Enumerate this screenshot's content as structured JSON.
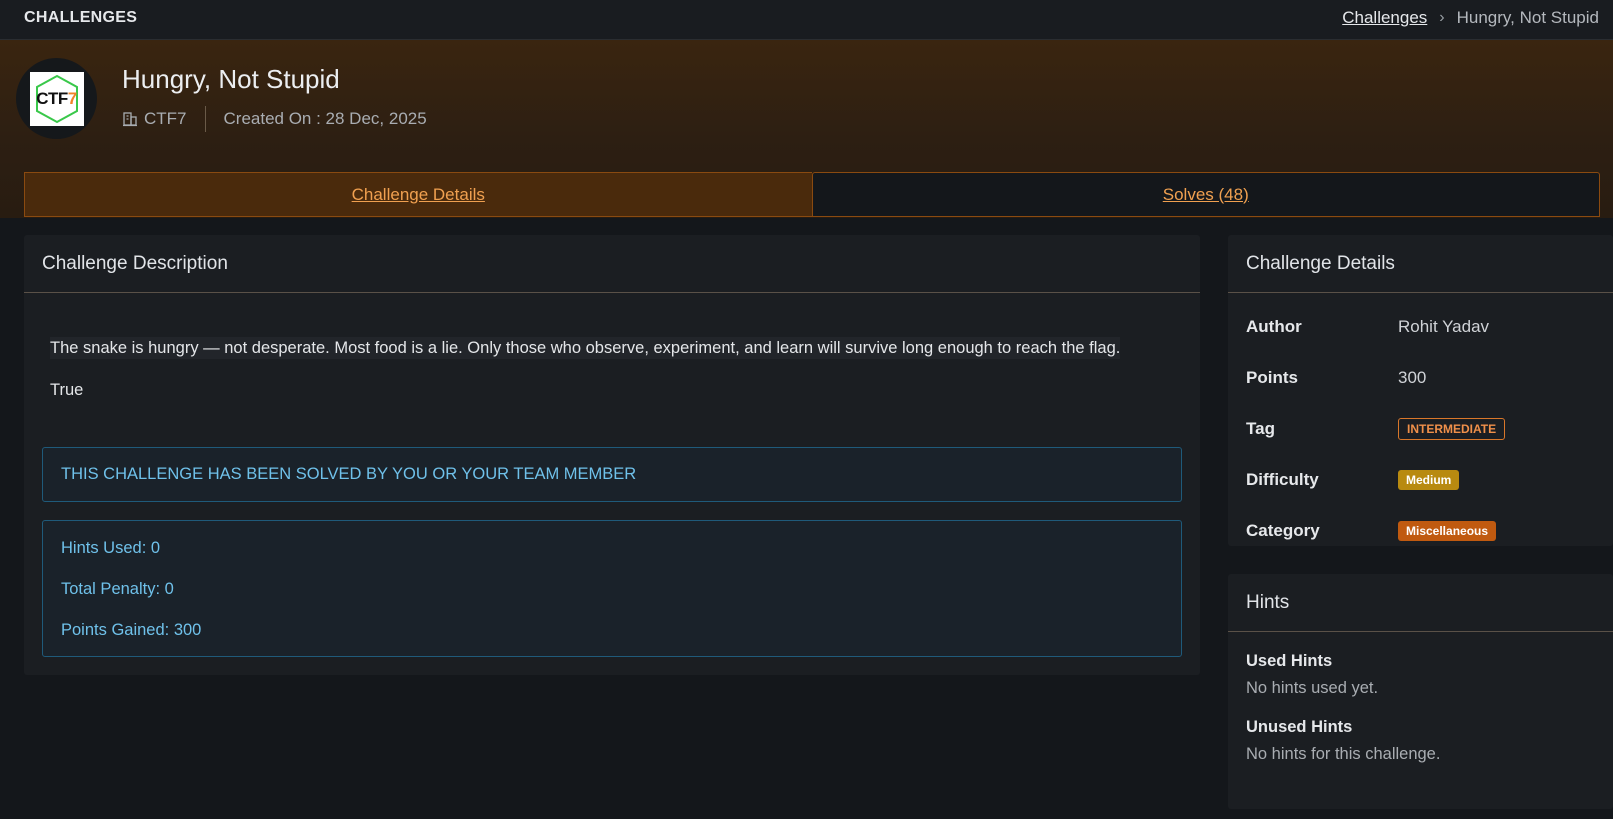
{
  "topbar": {
    "title": "CHALLENGES",
    "breadcrumb": {
      "link": "Challenges",
      "separator": "›",
      "current": "Hungry, Not Stupid"
    }
  },
  "header": {
    "logo_text": "CTF",
    "logo_digit": "7",
    "title": "Hungry, Not Stupid",
    "organization_icon": "building-icon",
    "organization": "CTF7",
    "created_on": "Created On : 28 Dec, 2025"
  },
  "tabs": [
    {
      "label": "Challenge Details",
      "active": true
    },
    {
      "label": "Solves (48)",
      "active": false
    }
  ],
  "description_card": {
    "title": "Challenge Description",
    "text": "The snake is hungry — not desperate. Most food is a lie. Only those who observe, experiment, and learn will survive long enough to reach the flag.",
    "extra": "True",
    "solved_message": "THIS CHALLENGE HAS BEEN SOLVED BY YOU OR YOUR TEAM MEMBER",
    "stats": {
      "hints_used": "Hints Used: 0",
      "total_penalty": "Total Penalty: 0",
      "points_gained": "Points Gained: 300"
    }
  },
  "details_card": {
    "title": "Challenge Details",
    "rows": [
      {
        "key": "Author",
        "value": "Rohit Yadav"
      },
      {
        "key": "Points",
        "value": "300"
      },
      {
        "key": "Tag",
        "value": "INTERMEDIATE"
      },
      {
        "key": "Difficulty",
        "value": "Medium"
      },
      {
        "key": "Category",
        "value": "Miscellaneous"
      }
    ]
  },
  "hints_card": {
    "title": "Hints",
    "used_label": "Used Hints",
    "used_text": "No hints used yet.",
    "unused_label": "Unused Hints",
    "unused_text": "No hints for this challenge."
  },
  "colors": {
    "accent": "#f0a050",
    "info": "#6fc1ea",
    "difficulty_medium": "#b88a10",
    "category": "#c05a10"
  }
}
